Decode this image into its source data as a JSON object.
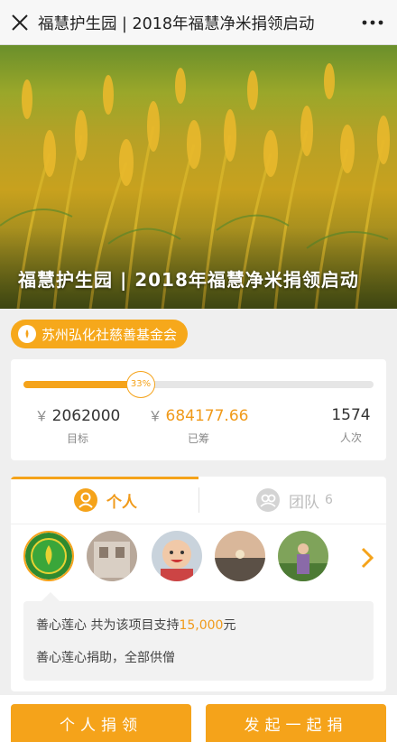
{
  "header": {
    "title": "福慧护生园 | 2018年福慧净米捐领启动",
    "close_icon": "close-icon",
    "more_icon": "more-icon"
  },
  "hero": {
    "caption": "福慧护生园 | 2018年福慧净米捐领启动",
    "image": "rice-field-photo"
  },
  "org": {
    "name": "苏州弘化社慈善基金会",
    "icon": "foundation-badge-icon"
  },
  "progress": {
    "percent_label": "33%",
    "percent": 33,
    "currency": "￥",
    "target_value": "2062000",
    "target_label": "目标",
    "raised_value": "684177.66",
    "raised_label": "已筹",
    "count_value": "1574",
    "count_label": "人次"
  },
  "tabs": {
    "personal_label": "个人",
    "team_label": "团队",
    "team_count": "6"
  },
  "message": {
    "donor_prefix": "善心莲心 共为该项目支持",
    "amount": "15,000",
    "unit": "元",
    "line2": "善心莲心捐助，全部供僧"
  },
  "footer": {
    "personal_button": "个人捐领",
    "launch_button": "发起一起捐"
  },
  "colors": {
    "accent": "#f5a31a",
    "accent_text": "#f09a1a"
  }
}
